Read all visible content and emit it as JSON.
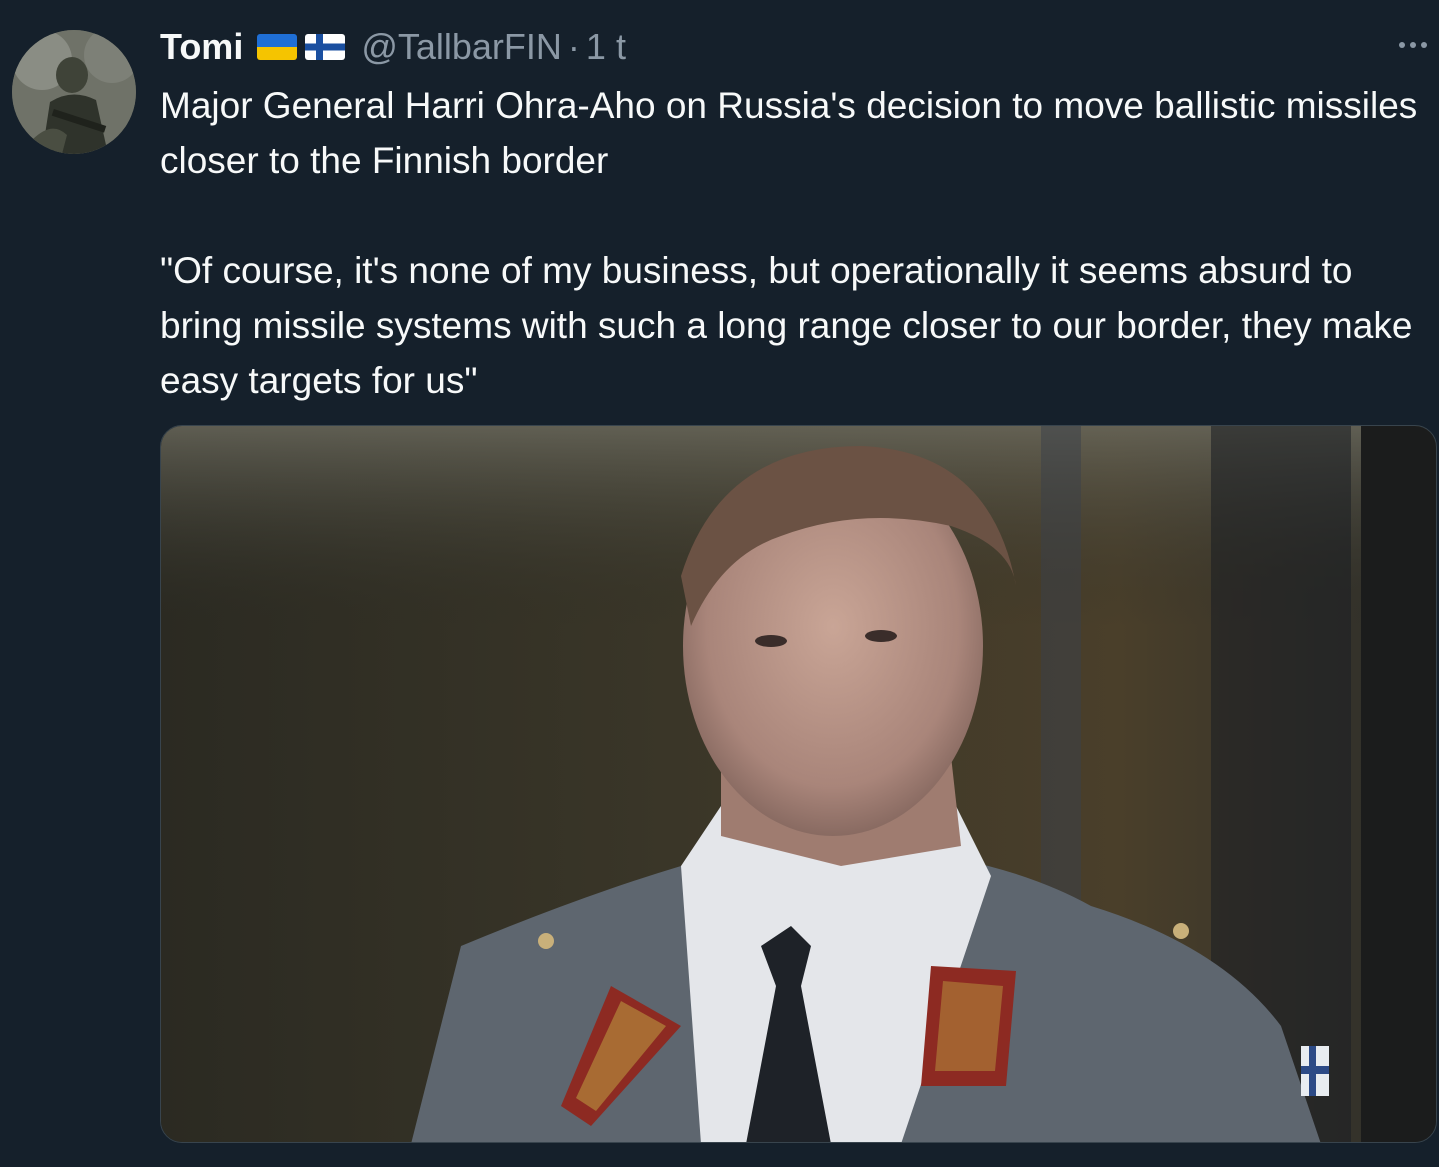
{
  "tweet": {
    "display_name": "Tomi",
    "flags": [
      "ukraine-flag",
      "finland-flag"
    ],
    "handle": "@TallbarFIN",
    "separator": "·",
    "time": "1 t",
    "more_label": "···",
    "text": "Major General Harri Ohra-Aho on Russia's decision to move ballistic missiles closer to the Finnish border\n\n\"Of course, it's none of my business, but operationally it seems absurd to bring missile systems with such a long range closer to our border, they make easy targets for us\""
  },
  "colors": {
    "background": "#15202b",
    "text_primary": "#f7f9f9",
    "text_secondary": "#8b98a5",
    "border": "#38444d"
  }
}
